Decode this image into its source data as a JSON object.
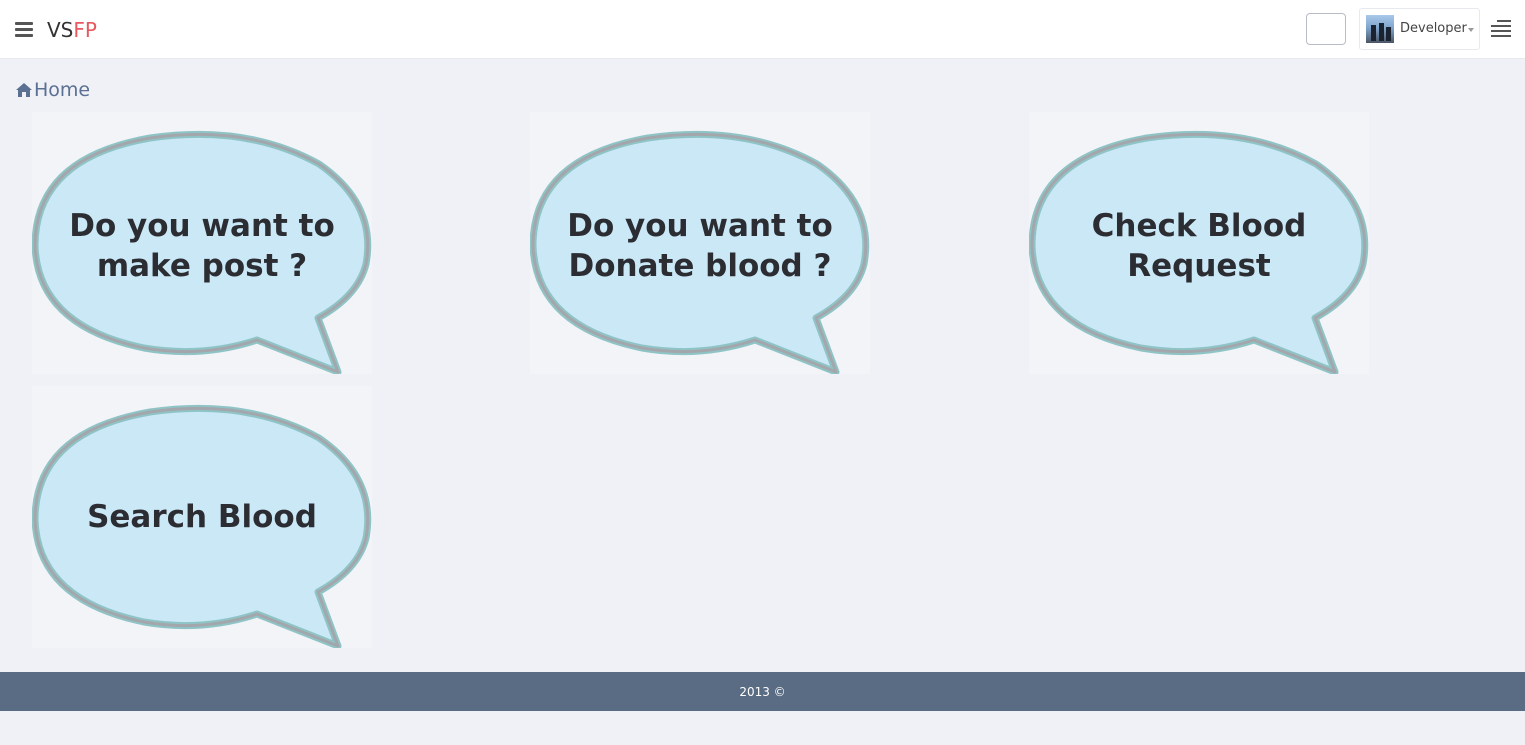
{
  "header": {
    "brand_prefix": "VS",
    "brand_accent": "FP",
    "user_name": "Developer"
  },
  "breadcrumb": {
    "home_label": "Home"
  },
  "tiles": [
    {
      "line1": "Do you want to",
      "line2": "make post ?"
    },
    {
      "line1": "Do you want to",
      "line2": "Donate blood ?"
    },
    {
      "line1": "Check Blood",
      "line2": "Request"
    },
    {
      "line1": "Search Blood",
      "line2": ""
    }
  ],
  "footer": {
    "text": "2013 ©"
  },
  "colors": {
    "brand_accent": "#e8585f",
    "bubble_fill": "#cbe8f7",
    "bubble_outline": "#8fb8bd",
    "footer_bg": "#5a6c84",
    "breadcrumb_text": "#5a6f92"
  },
  "icons": {
    "menu": "hamburger-icon",
    "breadcrumb": "home-icon",
    "right_menu": "align-right-icon",
    "user_dropdown": "caret-down-icon"
  }
}
